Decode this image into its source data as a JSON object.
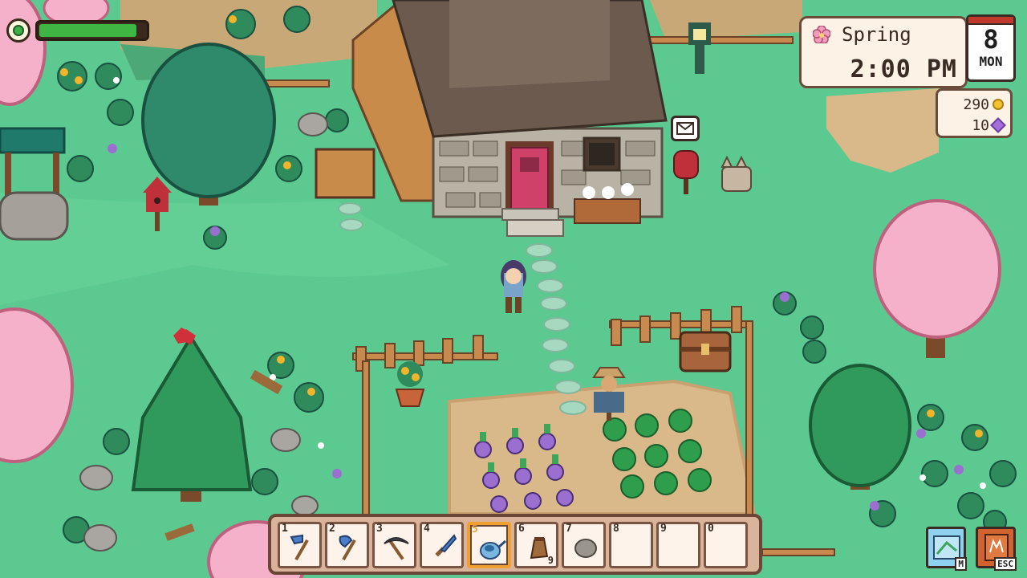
{
  "hud": {
    "energy": {
      "level": 0.92,
      "color": "#3fb544"
    },
    "clock": {
      "season": "Spring",
      "time": "2:00 PM",
      "day": "8",
      "weekday": "MON"
    },
    "money": {
      "gold": "290",
      "gems": "10"
    }
  },
  "hotbar": {
    "selected": 5,
    "slots": [
      {
        "key": "1",
        "item": "hoe-icon"
      },
      {
        "key": "2",
        "item": "axe-icon"
      },
      {
        "key": "3",
        "item": "pickaxe-icon"
      },
      {
        "key": "4",
        "item": "sickle-icon"
      },
      {
        "key": "5",
        "item": "watering-can-icon"
      },
      {
        "key": "6",
        "item": "seed-bag-icon",
        "qty": "9"
      },
      {
        "key": "7",
        "item": "stone-icon"
      },
      {
        "key": "8",
        "item": ""
      },
      {
        "key": "9",
        "item": ""
      },
      {
        "key": "0",
        "item": ""
      }
    ]
  },
  "buttons": {
    "map_key": "M",
    "menu_key": "ESC"
  },
  "colors": {
    "grass": "#5cc990",
    "dirt": "#d9b88a",
    "blossom": "#f2a8c4",
    "pine": "#2f8a5c"
  }
}
